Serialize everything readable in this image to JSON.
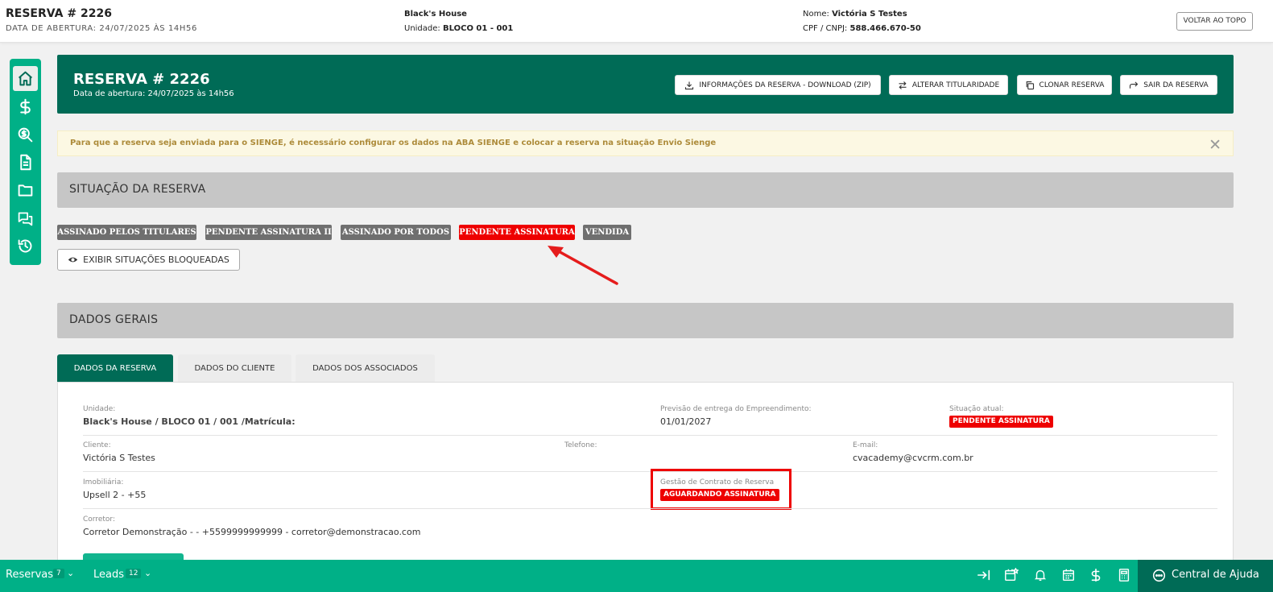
{
  "topbar": {
    "title": "RESERVA # 2226",
    "subtitle": "DATA DE ABERTURA: 24/07/2025 ÀS 14H56",
    "project": "Black's House",
    "unit_label": "Unidade:",
    "unit_value": "BLOCO 01 - 001",
    "name_label": "Nome:",
    "name_value": "Victória S Testes",
    "cpf_label": "CPF / CNPJ:",
    "cpf_value": "588.466.670-50",
    "back_top": "VOLTAR AO TOPO"
  },
  "sidebar": {
    "items": [
      "home-icon",
      "dollar-icon",
      "search-money-icon",
      "document-icon",
      "folder-icon",
      "chat-icon",
      "history-icon"
    ]
  },
  "hero": {
    "title": "RESERVA # 2226",
    "subtitle": "Data de abertura: 24/07/2025 às 14h56",
    "buttons": {
      "download": "INFORMAÇÕES DA RESERVA - DOWNLOAD (ZIP)",
      "change_owner": "ALTERAR TITULARIDADE",
      "clone": "CLONAR RESERVA",
      "exit": "SAIR DA RESERVA"
    }
  },
  "alert": {
    "text": "Para que a reserva seja enviada para o SIENGE, é necessário configurar os dados na ABA SIENGE e colocar a reserva na situação Envio Sienge",
    "close": "✕"
  },
  "situacao": {
    "title": "SITUAÇÃO DA RESERVA",
    "tags": [
      "ASSINADO PELOS TITULARES",
      "PENDENTE ASSINATURA II",
      "ASSINADO POR TODOS",
      "PENDENTE ASSINATURA",
      "VENDIDA"
    ],
    "show_blocked": "EXIBIR SITUAÇÕES BLOQUEADAS"
  },
  "dados_gerais": {
    "title": "DADOS GERAIS",
    "tabs": [
      "DADOS DA RESERVA",
      "DADOS DO CLIENTE",
      "DADOS DOS ASSOCIADOS"
    ]
  },
  "reserva": {
    "unidade_label": "Unidade:",
    "unidade_value": "Black's House / BLOCO 01 / 001 /Matrícula:",
    "previsao_label": "Previsão de entrega do Empreendimento:",
    "previsao_value": "01/01/2027",
    "situacao_label": "Situação atual:",
    "situacao_value": "PENDENTE ASSINATURA",
    "cliente_label": "Cliente:",
    "cliente_value": "Victória S Testes",
    "telefone_label": "Telefone:",
    "email_label": "E-mail:",
    "email_value": "cvacademy@cvcrm.com.br",
    "imobiliaria_label": "Imobiliária:",
    "imobiliaria_value": "Upsell 2 - +55",
    "gestao_label": "Gestão de Contrato de Reserva",
    "gestao_value": "AGUARDANDO ASSINATURA",
    "corretor_label": "Corretor:",
    "corretor_value": "Corretor Demonstração - - +5599999999999 - corretor@demonstracao.com"
  },
  "bottombar": {
    "reservas_label": "Reservas",
    "reservas_count": "7",
    "leads_label": "Leads",
    "leads_count": "12",
    "help": "Central de Ajuda"
  },
  "colors": {
    "dark_green": "#006b56",
    "green": "#00b087",
    "red": "#ee0000",
    "gray_tag": "#6f6f6f"
  }
}
